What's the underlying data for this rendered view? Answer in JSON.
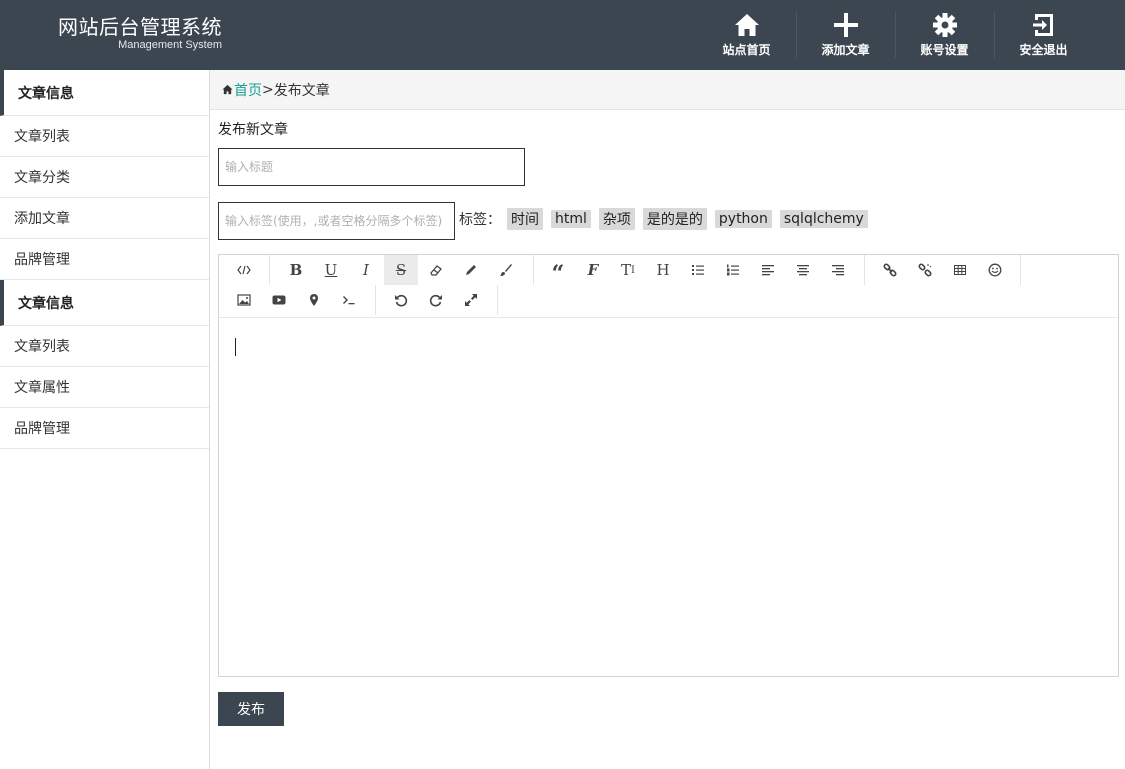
{
  "header": {
    "title": "网站后台管理系统",
    "subtitle": "Management System",
    "nav": [
      {
        "label": "站点首页",
        "icon": "home-icon"
      },
      {
        "label": "添加文章",
        "icon": "plus-icon"
      },
      {
        "label": "账号设置",
        "icon": "gear-icon"
      },
      {
        "label": "安全退出",
        "icon": "logout-icon"
      }
    ]
  },
  "sidebar": {
    "groups": [
      {
        "title": "文章信息",
        "items": [
          "文章列表",
          "文章分类",
          "添加文章",
          "品牌管理"
        ]
      },
      {
        "title": "文章信息",
        "items": [
          "文章列表",
          "文章属性",
          "品牌管理"
        ]
      }
    ]
  },
  "breadcrumb": {
    "home": "首页",
    "separator": ">",
    "current": "发布文章"
  },
  "form": {
    "page_title": "发布新文章",
    "title_placeholder": "输入标题",
    "tag_placeholder": "输入标签(使用，,或者空格分隔多个标签)",
    "tags_label": "标签：",
    "tags": [
      "时间",
      "html",
      "杂项",
      "是的是的",
      "python",
      "sqlqlchemy"
    ],
    "publish_label": "发布"
  },
  "colors": {
    "header_bg": "#3b4650",
    "accent_link": "#1aa094"
  }
}
